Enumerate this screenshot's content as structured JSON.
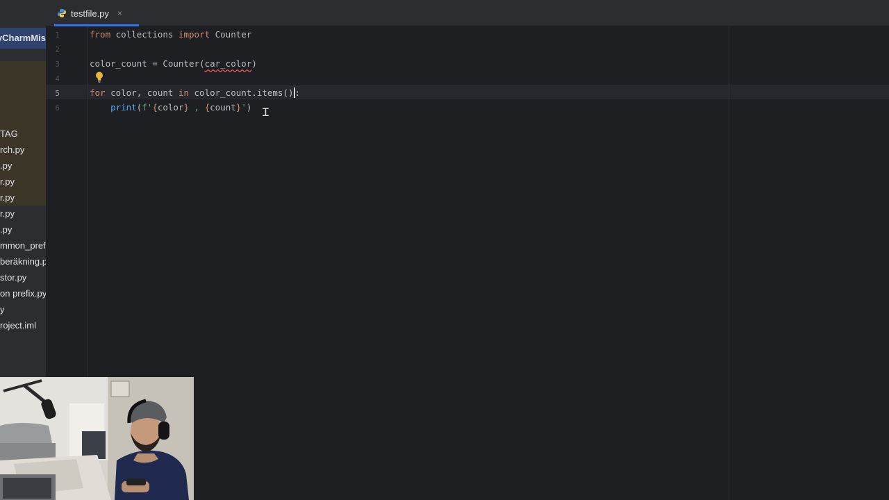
{
  "sidebar": {
    "root_label": "yCharmMis",
    "items": [
      {
        "label": "TAG"
      },
      {
        "label": "rch.py"
      },
      {
        "label": ".py"
      },
      {
        "label": "r.py"
      },
      {
        "label": "r.py"
      },
      {
        "label": "r.py"
      },
      {
        "label": ".py"
      },
      {
        "label": "mmon_prefi"
      },
      {
        "label": "beräkning.p"
      },
      {
        "label": "stor.py"
      },
      {
        "label": "on prefix.py"
      },
      {
        "label": "y"
      },
      {
        "label": "roject.iml"
      }
    ]
  },
  "tab": {
    "file_name": "testfile.py",
    "close_glyph": "×",
    "icon": "python-icon"
  },
  "editor": {
    "active_line": 5,
    "lines": [
      {
        "number": "1",
        "tokens": [
          {
            "t": "from",
            "c": "kw"
          },
          {
            "t": " collections "
          },
          {
            "t": "import",
            "c": "kw"
          },
          {
            "t": " Counter"
          }
        ]
      },
      {
        "number": "2",
        "tokens": []
      },
      {
        "number": "3",
        "tokens": [
          {
            "t": "color_count = Counter("
          },
          {
            "t": "car_color",
            "c": "err"
          },
          {
            "t": ")"
          }
        ]
      },
      {
        "number": "4",
        "tokens": []
      },
      {
        "number": "5",
        "tokens": [
          {
            "t": "for",
            "c": "kw"
          },
          {
            "t": " color, count "
          },
          {
            "t": "in",
            "c": "kw"
          },
          {
            "t": " color_count.items()"
          },
          {
            "t": "",
            "c": "cursor"
          },
          {
            "t": ":"
          }
        ]
      },
      {
        "number": "6",
        "tokens": [
          {
            "t": "    print",
            "c": "fn"
          },
          {
            "t": "("
          },
          {
            "t": "f'",
            "c": "str"
          },
          {
            "t": "{",
            "c": "inter"
          },
          {
            "t": "color"
          },
          {
            "t": "}",
            "c": "inter"
          },
          {
            "t": " , ",
            "c": "str"
          },
          {
            "t": "{",
            "c": "inter"
          },
          {
            "t": "count"
          },
          {
            "t": "}",
            "c": "inter"
          },
          {
            "t": "'",
            "c": "str"
          },
          {
            "t": ")"
          }
        ]
      }
    ]
  },
  "colors": {
    "accent": "#3574f0",
    "keyword": "#cf8e6d",
    "string": "#6aab73",
    "function": "#56a8f5",
    "error": "#f75464"
  }
}
